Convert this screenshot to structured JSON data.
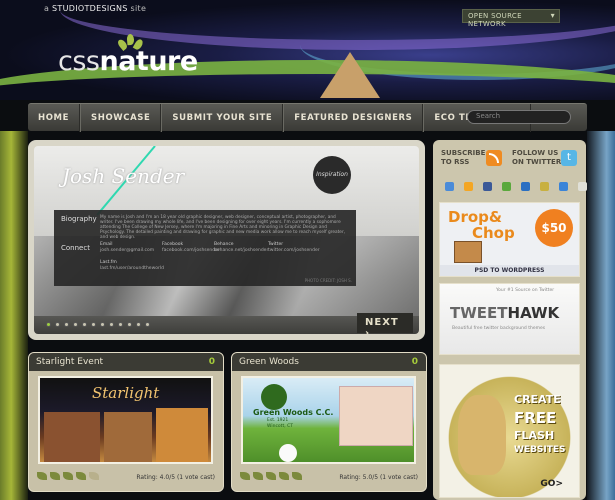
{
  "header": {
    "site_prefix": "a",
    "site_name": "STUDIOTDESIGNS",
    "site_suffix": "site",
    "network_label": "OPEN SOURCE NETWORK",
    "logo_part1": "css",
    "logo_part2": "nature"
  },
  "nav": {
    "items": [
      "HOME",
      "SHOWCASE",
      "SUBMIT YOUR SITE",
      "FEATURED DESIGNERS",
      "ECO TEMPLATES"
    ],
    "search_placeholder": "Search"
  },
  "featured": {
    "name": "Josh Sender",
    "badge": "Inspiration",
    "biography_label": "Biography",
    "biography_text": "My name is Josh and I'm an 18 year old graphic designer, web designer, conceptual artist, photographer, and writer. I've been drawing my whole life, and I've been designing for over eight years. I'm currently a sophomore attending The College of New Jersey, where I'm majoring in Fine Arts and minoring in Graphic Design and Psychology. The detailed painting and drawing for graphic and new media work allow me to reach myself greater, and web design.",
    "connect_label": "Connect",
    "contacts": [
      {
        "label": "Email",
        "value": "josh.sender@gmail.com"
      },
      {
        "label": "Facebook",
        "value": "facebook.com/joshsender"
      },
      {
        "label": "Behance",
        "value": "behance.net/joshsender"
      },
      {
        "label": "Twitter",
        "value": "twitter.com/joshsender"
      }
    ],
    "lastfm_label": "Last.fm",
    "lastfm_value": "last.fm/user/aroundtheworld",
    "credit": "PHOTO CREDIT: JOSH S.",
    "dots_total": 12,
    "dots_active": 1,
    "next_label": "NEXT"
  },
  "cards": [
    {
      "title": "Starlight Event",
      "count": "0",
      "rating": "Rating: 4.0/5 (1 vote cast)",
      "leaves": 4,
      "thumb_title": "Starlight"
    },
    {
      "title": "Green Woods",
      "count": "0",
      "rating": "Rating: 5.0/5 (1 vote cast)",
      "leaves": 5,
      "thumb_title": "Green Woods C.C.",
      "thumb_sub": "Est. 1921",
      "thumb_sub2": "Wincott, CT"
    }
  ],
  "sidebar": {
    "subscribe_line1": "SUBSCRIBE",
    "subscribe_line2": "TO RSS",
    "follow_line1": "FOLLOW US",
    "follow_line2": "ON TWITTER",
    "bookmark_colors": [
      "#4a8bd8",
      "#f4a623",
      "#3b5998",
      "#5aa83c",
      "#2a6fc2",
      "#c8b040",
      "#3a84d8",
      "#e0e0d8"
    ],
    "ad1": {
      "line1": "Drop",
      "line2": "&",
      "line3": "Chop",
      "price": "$50",
      "caption": "PSD TO WORDPRESS"
    },
    "ad2": {
      "top": "Your #1 Source on Twitter",
      "brand1": "TWEET",
      "brand2": "HAWK",
      "sub": "Beautiful free twitter background themes"
    },
    "ad3": {
      "words": [
        "CREATE",
        "FREE",
        "FLASH",
        "WEBSITES"
      ],
      "go": "GO>"
    }
  }
}
